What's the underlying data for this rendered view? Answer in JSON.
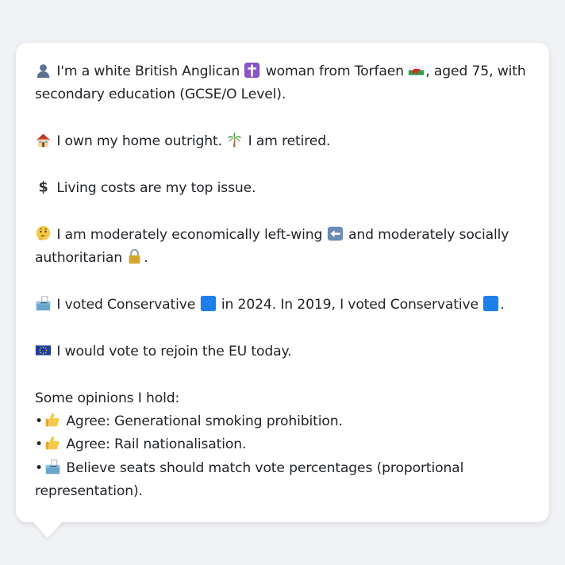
{
  "profile": {
    "identity": {
      "pre": "I'm a white British Anglican",
      "mid": "woman from Torfaen",
      "post": ", aged 75, with secondary education (GCSE/O Level)."
    },
    "housing": {
      "home": "I own my home outright.",
      "work": "I am retired."
    },
    "top_issue": "Living costs are my top issue.",
    "politics": {
      "pre": "I am moderately economically left-wing",
      "mid": "and moderately socially authoritarian",
      "post": "."
    },
    "vote": {
      "pre": "I voted Conservative",
      "mid": "in 2024. In 2019, I voted Conservative",
      "post": "."
    },
    "eu": "I would vote to rejoin the EU today.",
    "opinions": {
      "heading": "Some opinions I hold:",
      "bullet": "•",
      "items": [
        "Agree: Generational smoking prohibition.",
        "Agree: Rail nationalisation.",
        "Believe seats should match vote percentages (proportional representation)."
      ]
    }
  },
  "icons": {
    "person": "person-silhouette-icon",
    "cross": "latin-cross-icon",
    "flag_wales": "wales-flag-icon",
    "house": "house-icon",
    "palm": "palm-tree-icon",
    "dollar": "dollar-sign-icon",
    "thinking": "thinking-face-icon",
    "left_arrow": "left-arrow-icon",
    "lock": "lock-icon",
    "ballot": "ballot-box-icon",
    "blue_square": "blue-square-icon",
    "eu_flag": "eu-flag-icon",
    "thumbs_up": "thumbs-up-icon"
  },
  "colors": {
    "background": "#f0f2f5",
    "card": "#ffffff",
    "text": "#1f2328",
    "conservative_blue": "#1d7fe8"
  }
}
